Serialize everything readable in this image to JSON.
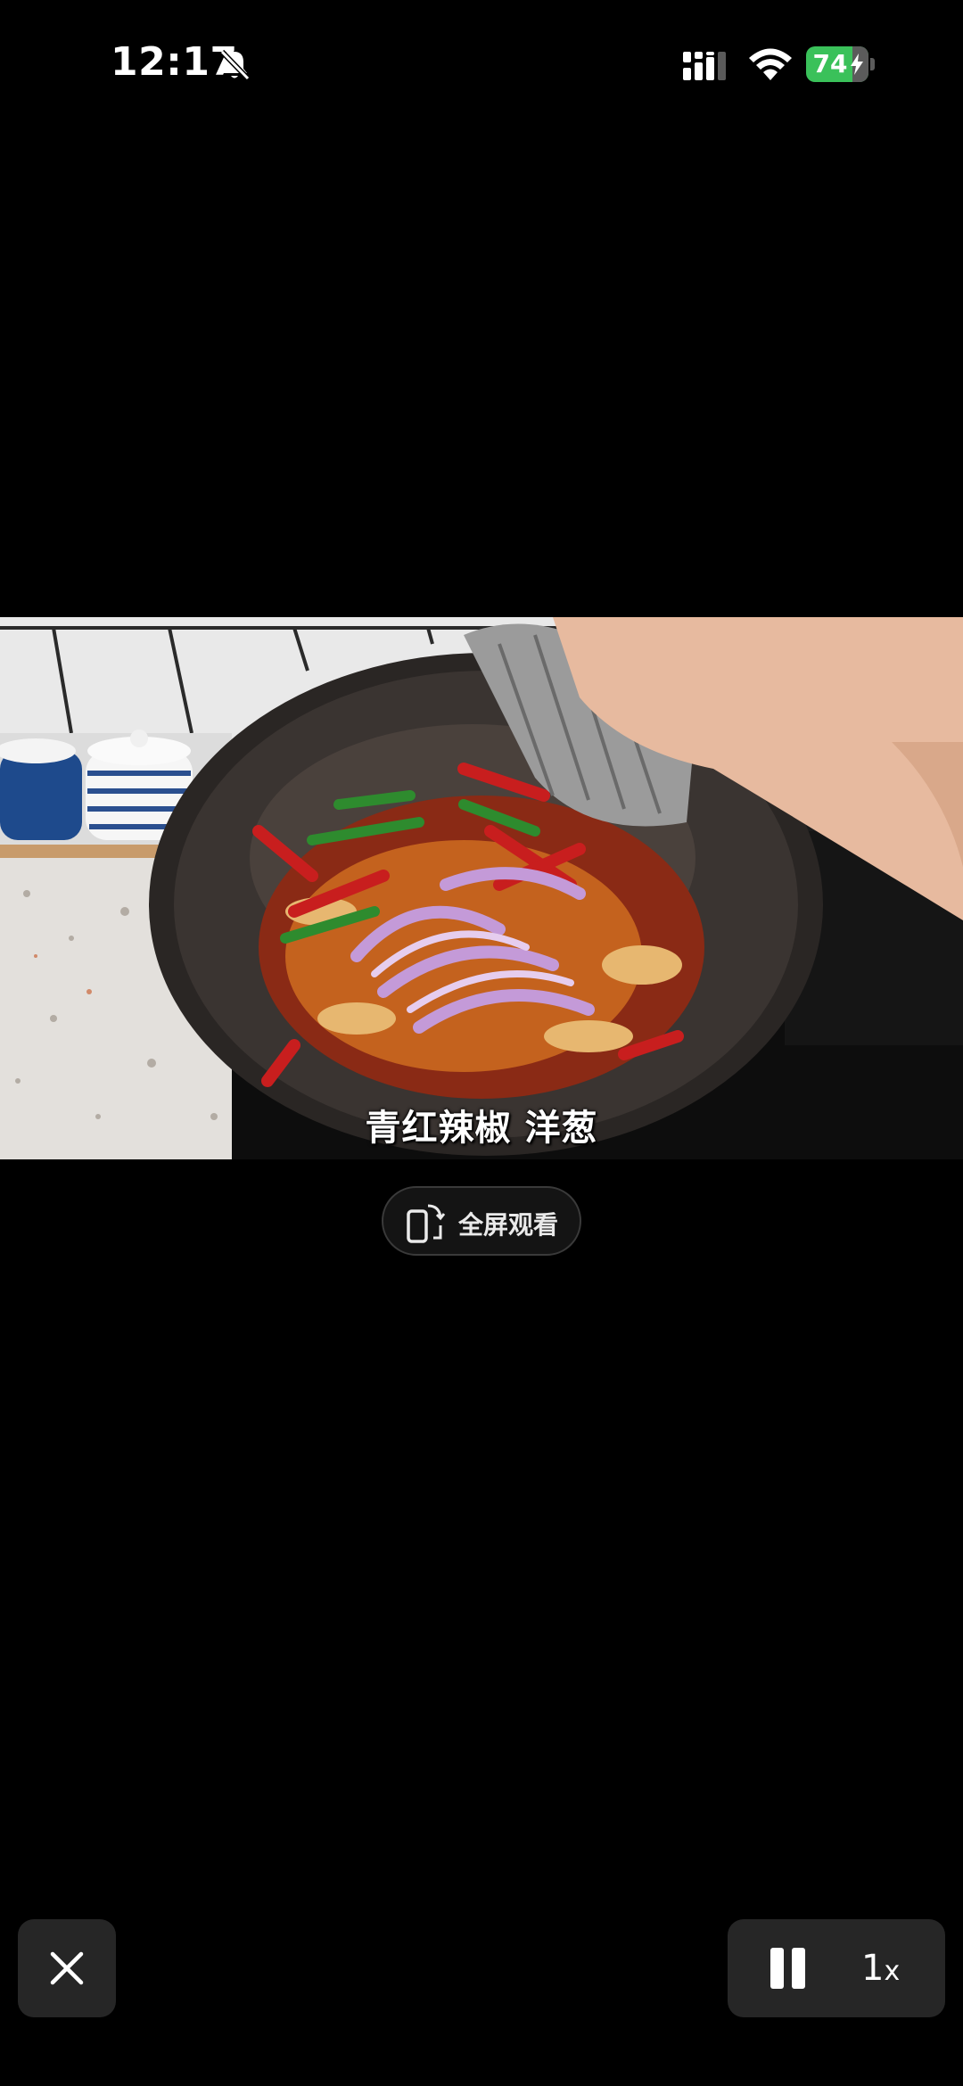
{
  "status_bar": {
    "time": "12:17",
    "battery_level": 74,
    "battery_text": "74",
    "charging": true,
    "silent_mode": true,
    "accent_color": "#3ac15a"
  },
  "video": {
    "subtitle": "青红辣椒 洋葱",
    "playing": true
  },
  "fullscreen_button": {
    "label": "全屏观看",
    "icon": "rotate-phone-icon"
  },
  "controls": {
    "close_icon": "close-icon",
    "pause_icon": "pause-icon",
    "speed_value": "1",
    "speed_suffix": "x"
  }
}
